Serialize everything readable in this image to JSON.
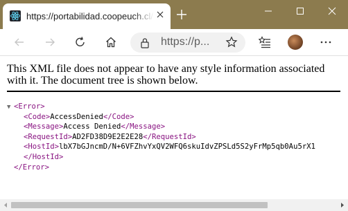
{
  "tab": {
    "title": "https://portabilidad.coopeuch.cl/"
  },
  "address_bar": {
    "url": "https://p..."
  },
  "colors": {
    "frame": "#8c7b4e",
    "xml_tag": "#881280"
  },
  "page": {
    "info_text": "This XML file does not appear to have any style information associated with it. The document tree is shown below.",
    "xml": {
      "error_open": "<Error>",
      "code_open": "<Code>",
      "code_value": "AccessDenied",
      "code_close": "</Code>",
      "message_open": "<Message>",
      "message_value": "Access Denied",
      "message_close": "</Message>",
      "requestid_open": "<RequestId>",
      "requestid_value": "AD2FD38D9E2E2E28",
      "requestid_close": "</RequestId>",
      "hostid_open": "<HostId>",
      "hostid_value": "lbX7bGJncmD/N+6VFZhvYxQV2WFQ6skuIdvZPSLd5S2yFrMp5qb0Au5rX1",
      "hostid_close": "</HostId>",
      "error_close": "</Error>"
    }
  }
}
